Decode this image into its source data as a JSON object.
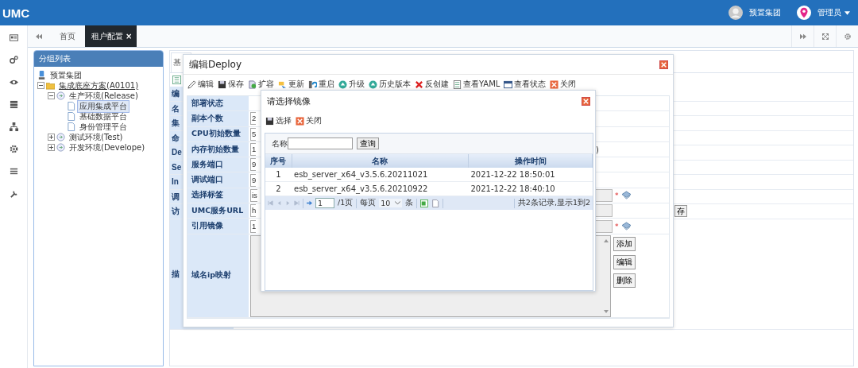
{
  "header": {
    "logo": "UMC",
    "org": "预置集团",
    "user": "管理员"
  },
  "tabs": [
    {
      "label": "首页",
      "selected": false
    },
    {
      "label": "租户配置",
      "selected": true,
      "close": "×"
    }
  ],
  "tree": {
    "title": "分组列表",
    "items": [
      {
        "label": "预置集团",
        "kind": "group",
        "selected": false
      },
      {
        "label": "集成底座方案(A0101)",
        "kind": "plan",
        "selected": false,
        "expanded": true,
        "children": [
          {
            "label": "生产环境(Release)",
            "kind": "env",
            "selected": false,
            "expanded": true,
            "children": [
              {
                "label": "应用集成平台",
                "kind": "page",
                "selected": true
              },
              {
                "label": "基础数据平台",
                "kind": "page",
                "selected": false
              },
              {
                "label": "身份管理平台",
                "kind": "page",
                "selected": false
              }
            ]
          },
          {
            "label": "测试环境(Test)",
            "kind": "env",
            "selected": false,
            "expanded": false
          },
          {
            "label": "开发环境(Develope)",
            "kind": "env",
            "selected": false,
            "expanded": false
          }
        ]
      }
    ]
  },
  "background_form": {
    "tab": "基",
    "labels": [
      "编",
      "名",
      "集",
      "命",
      "De",
      "Se",
      "In",
      "调",
      "访"
    ],
    "tall_label": "描",
    "button": "存"
  },
  "deploy_dialog": {
    "title": "编辑Deploy",
    "toolbar": [
      {
        "label": "编辑",
        "kind": "edit"
      },
      {
        "label": "保存",
        "kind": "save"
      },
      {
        "label": "扩容",
        "kind": "scale"
      },
      {
        "label": "更新",
        "kind": "update"
      },
      {
        "label": "重启",
        "kind": "restart"
      },
      {
        "label": "升级",
        "kind": "upgrade"
      },
      {
        "label": "历史版本",
        "kind": "upgrade"
      },
      {
        "label": "反创建",
        "kind": "delete"
      },
      {
        "label": "查看YAML",
        "kind": "list"
      },
      {
        "label": "查看状态",
        "kind": "window"
      },
      {
        "label": "关闭",
        "kind": "close"
      }
    ],
    "fields": [
      {
        "label": "部署状态"
      },
      {
        "label": "副本个数",
        "value": "2"
      },
      {
        "label": "CPU初始数量",
        "value": "5"
      },
      {
        "label": "内存初始数量",
        "value": "1",
        "tail": ")"
      },
      {
        "label": "服务端口",
        "value": "9"
      },
      {
        "label": "调试端口",
        "value": "9"
      },
      {
        "label": "选择标签",
        "value": "is",
        "field_end": true,
        "mark": "*",
        "picker": true
      },
      {
        "label": "UMC服务URL",
        "value": "h",
        "field_end": true
      },
      {
        "label": "引用镜像",
        "value": "1",
        "field_end": true,
        "mark": "*",
        "picker": true
      }
    ],
    "mapping": {
      "label": "域名ip映射",
      "buttons": [
        "添加",
        "编辑",
        "删除"
      ]
    }
  },
  "image_dialog": {
    "title": "请选择镜像",
    "toolbar": [
      {
        "label": "选择",
        "kind": "save"
      },
      {
        "label": "关闭",
        "kind": "close"
      }
    ],
    "search_label": "名称",
    "search_button": "查询",
    "columns": [
      "序号",
      "名称",
      "操作时间"
    ],
    "rows": [
      [
        "1",
        "esb_server_x64_v3.5.6.20211021",
        "2021-12-22 18:50:01"
      ],
      [
        "2",
        "esb_server_x64_v3.5.6.20210922",
        "2021-12-22 18:40:10"
      ]
    ],
    "pager": {
      "page": "1",
      "pages": "/1页",
      "per_page_label": "每页",
      "per_page": "10",
      "unit": "条",
      "summary": "共2条记录,显示1到2"
    }
  }
}
